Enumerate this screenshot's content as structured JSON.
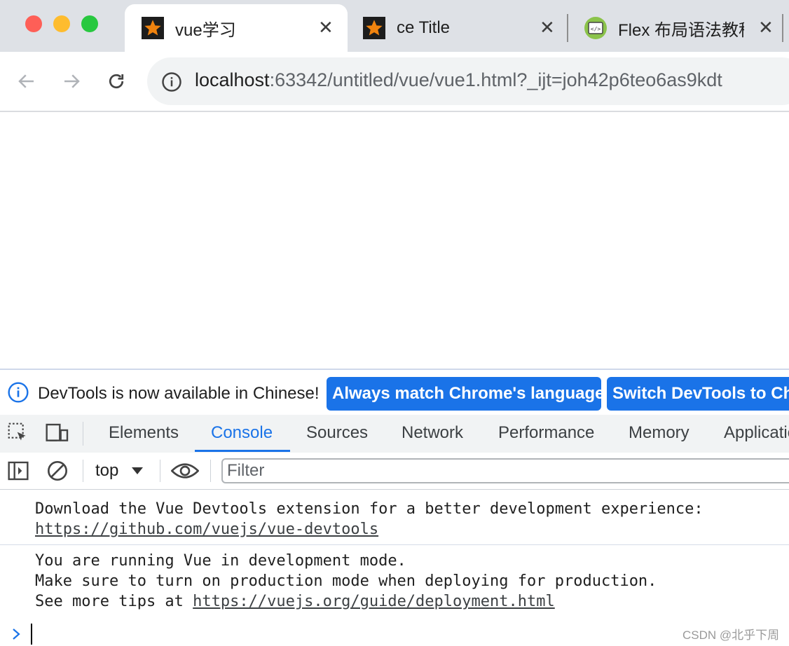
{
  "browser": {
    "tabs": [
      {
        "title": "vue学习",
        "icon": "star-icon",
        "active": true
      },
      {
        "title": "ce Title",
        "icon": "star-icon",
        "active": false
      },
      {
        "title": "Flex 布局语法教程",
        "icon": "code-icon",
        "active": false
      }
    ],
    "close_glyph": "✕",
    "url_host": "localhost",
    "url_rest": ":63342/untitled/vue/vue1.html?_ijt=joh42p6teo6as9kdt"
  },
  "devtools": {
    "infobar": {
      "message": "DevTools is now available in Chinese!",
      "button_match": "Always match Chrome's language",
      "button_switch": "Switch DevTools to Chinese"
    },
    "tabs": [
      "Elements",
      "Console",
      "Sources",
      "Network",
      "Performance",
      "Memory",
      "Application"
    ],
    "active_tab": "Console",
    "context": "top",
    "filter_placeholder": "Filter",
    "console": {
      "msg1_line1": "Download the Vue Devtools extension for a better development experience:",
      "msg1_link": "https://github.com/vuejs/vue-devtools",
      "msg2_line1": "You are running Vue in development mode.",
      "msg2_line2": "Make sure to turn on production mode when deploying for production.",
      "msg2_line3_prefix": "See more tips at ",
      "msg2_link": "https://vuejs.org/guide/deployment.html"
    }
  },
  "watermark": "CSDN @北乎下周",
  "colors": {
    "accent": "#1a73e8",
    "tabstrip": "#dee1e6"
  }
}
